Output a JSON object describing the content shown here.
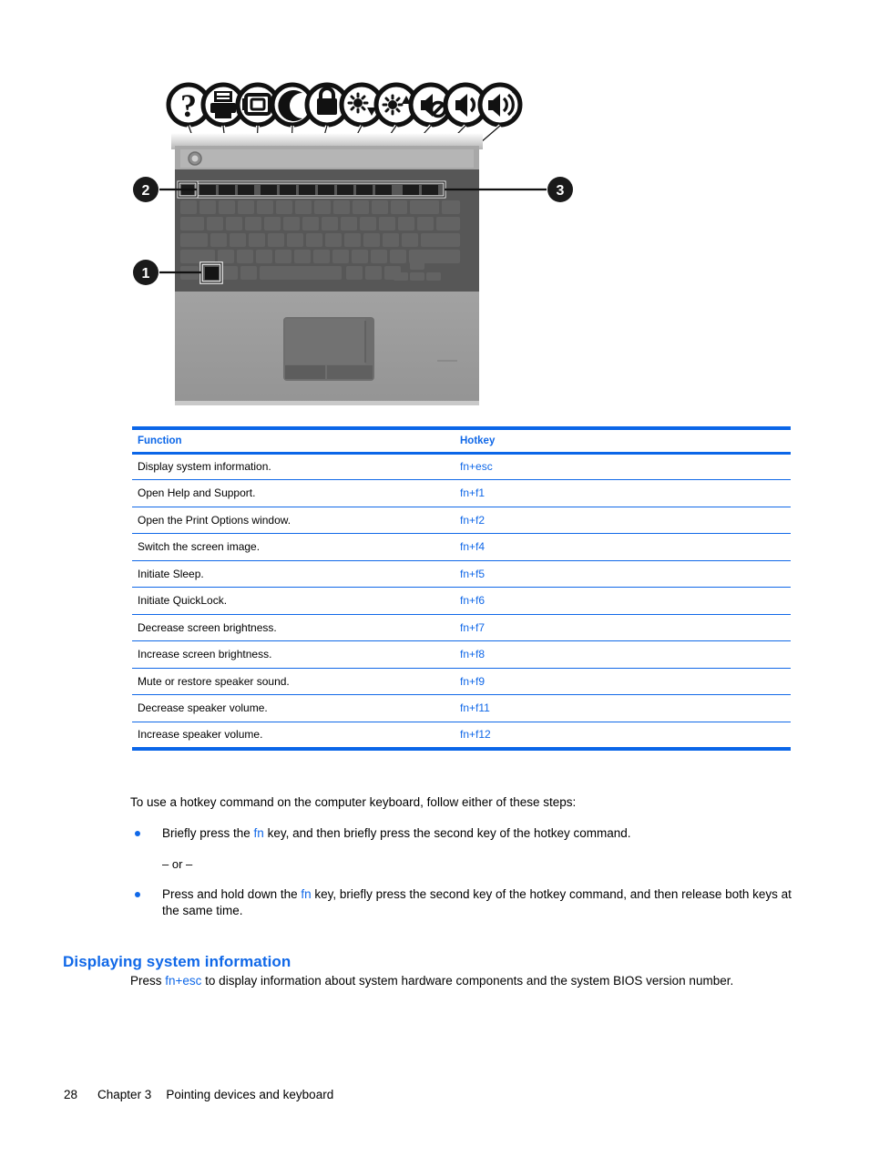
{
  "illustration": {
    "alt": "Top view of notebook computer keyboard with hotkey callouts",
    "callouts": [
      {
        "id": "1",
        "label": "1",
        "target": "fn-key"
      },
      {
        "id": "2",
        "label": "2",
        "target": "esc-key"
      },
      {
        "id": "3",
        "label": "3",
        "target": "function-key-row"
      }
    ],
    "hotkey_icons": [
      {
        "name": "help-question-icon",
        "glyph": "?"
      },
      {
        "name": "printer-icon",
        "glyph": "printer"
      },
      {
        "name": "display-switch-icon",
        "glyph": "monitor"
      },
      {
        "name": "sleep-moon-icon",
        "glyph": "moon"
      },
      {
        "name": "quicklock-padlock-icon",
        "glyph": "lock"
      },
      {
        "name": "brightness-decrease-icon",
        "glyph": "sun-down"
      },
      {
        "name": "brightness-increase-icon",
        "glyph": "sun-up"
      },
      {
        "name": "speaker-mute-icon",
        "glyph": "speaker-mute"
      },
      {
        "name": "volume-decrease-icon",
        "glyph": "speaker"
      },
      {
        "name": "volume-increase-icon",
        "glyph": "speaker-waves"
      }
    ]
  },
  "table": {
    "headers": {
      "function": "Function",
      "hotkey": "Hotkey"
    },
    "rows": [
      {
        "function": "Display system information.",
        "hotkey": "fn+esc"
      },
      {
        "function": "Open Help and Support.",
        "hotkey": "fn+f1"
      },
      {
        "function": "Open the Print Options window.",
        "hotkey": "fn+f2"
      },
      {
        "function": "Switch the screen image.",
        "hotkey": "fn+f4"
      },
      {
        "function": "Initiate Sleep.",
        "hotkey": "fn+f5"
      },
      {
        "function": "Initiate QuickLock.",
        "hotkey": "fn+f6"
      },
      {
        "function": "Decrease screen brightness.",
        "hotkey": "fn+f7"
      },
      {
        "function": "Increase screen brightness.",
        "hotkey": "fn+f8"
      },
      {
        "function": "Mute or restore speaker sound.",
        "hotkey": "fn+f9"
      },
      {
        "function": "Decrease speaker volume.",
        "hotkey": "fn+f11"
      },
      {
        "function": "Increase speaker volume.",
        "hotkey": "fn+f12"
      }
    ]
  },
  "body": {
    "intro": "To use a hotkey command on the computer keyboard, follow either of these steps:",
    "bullet_1_before": "Briefly press the ",
    "bullet_1_key": "fn",
    "bullet_1_after": " key, and then briefly press the second key of the hotkey command.",
    "or_separator": "– or –",
    "bullet_2_before": "Press and hold down the ",
    "bullet_2_key": "fn",
    "bullet_2_after": " key, briefly press the second key of the hotkey command, and then release both keys at the same time.",
    "heading": "Displaying system information",
    "closing_before": "Press ",
    "closing_key": "fn+esc",
    "closing_after": " to display information about system hardware components and the system BIOS version number."
  },
  "footer": {
    "page_number": "28",
    "chapter": "Chapter 3",
    "chapter_title": "Pointing devices and keyboard"
  },
  "colors": {
    "accent_blue": "#0B66E8",
    "link_blue": "#1068E8",
    "text_black": "#000000"
  }
}
